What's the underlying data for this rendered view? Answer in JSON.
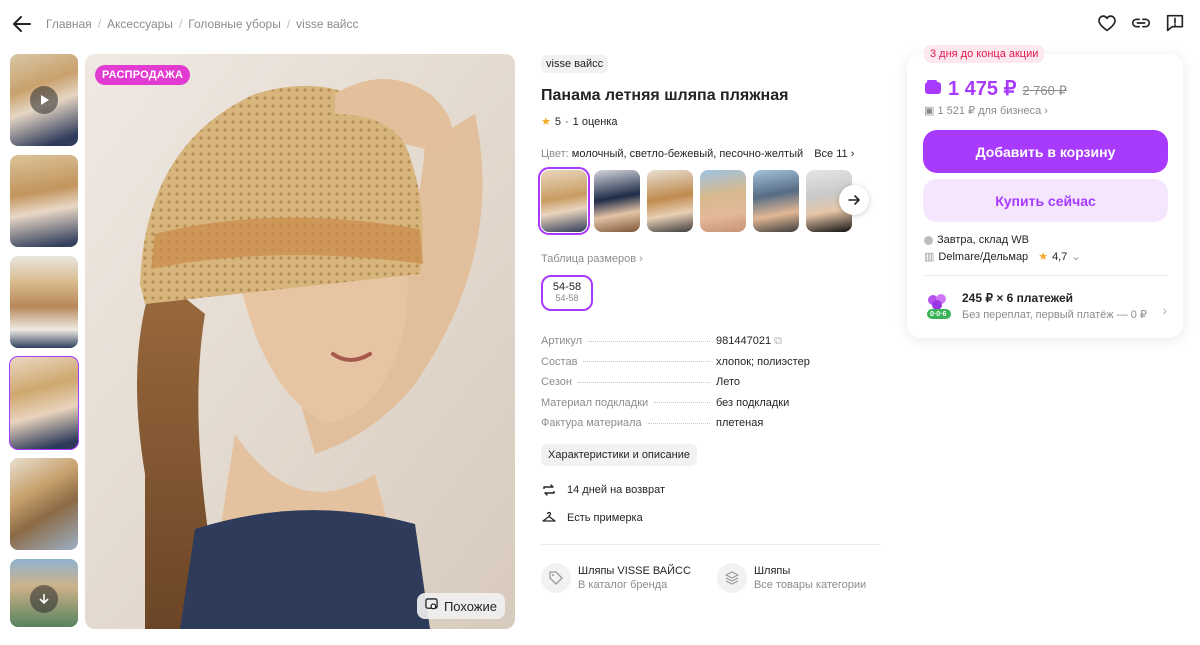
{
  "breadcrumb": [
    "Главная",
    "Аксессуары",
    "Головные уборы",
    "visse вайсс"
  ],
  "gallery": {
    "sale_badge": "РАСПРОДАЖА",
    "similar_label": "Похожие"
  },
  "product": {
    "brand": "visse вайсс",
    "title": "Панама летняя шляпа пляжная",
    "rating": "5",
    "reviews": "1 оценка",
    "color_label": "Цвет:",
    "color_value": "молочный, светло-бежевый, песочно-желтый",
    "colors_all": "Все 11",
    "size_table": "Таблица размеров",
    "size": "54-58",
    "size_sub": "54-58",
    "specs": [
      {
        "k": "Артикул",
        "v": "981447021"
      },
      {
        "k": "Состав",
        "v": "хлопок; полиэстер"
      },
      {
        "k": "Сезон",
        "v": "Лето"
      },
      {
        "k": "Материал подкладки",
        "v": "без подкладки"
      },
      {
        "k": "Фактура материала",
        "v": "плетеная"
      }
    ],
    "specs_button": "Характеристики и описание",
    "features": [
      "14 дней на возврат",
      "Есть примерка"
    ],
    "links": [
      {
        "t1": "Шляпы VISSE ВАЙСС",
        "t2": "В каталог бренда"
      },
      {
        "t1": "Шляпы",
        "t2": "Все товары категории"
      }
    ]
  },
  "buy": {
    "promo": "3 дня до конца акции",
    "price": "1 475 ₽",
    "old_price": "2 760 ₽",
    "business_price": "1 521 ₽ для бизнеса",
    "cart_button": "Добавить в корзину",
    "buy_button": "Купить сейчас",
    "delivery": "Завтра, склад WB",
    "seller": "Delmare/Дельмар",
    "seller_rating": "4,7",
    "installment": "245 ₽ × 6 платежей",
    "installment_sub": "Без переплат, первый платёж — 0 ₽",
    "installment_badge": "0·0·6"
  },
  "colors": {
    "accent": "#a73afd",
    "promo": "#e0194e",
    "sale": "#e23bd1"
  }
}
